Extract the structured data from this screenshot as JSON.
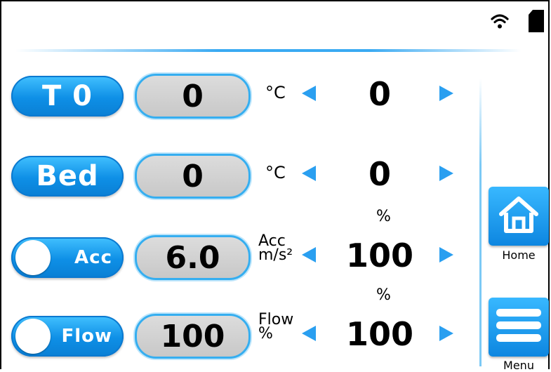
{
  "status": {
    "wifi_icon": "wifi-icon",
    "sd_icon": "sd-card-icon"
  },
  "rows": [
    {
      "label": "T 0",
      "value": "0",
      "unit": "°C",
      "target": "0"
    },
    {
      "label": "Bed",
      "value": "0",
      "unit": "°C",
      "target": "0"
    },
    {
      "label": "Acc",
      "value": "6.0",
      "unit_line1": "Acc",
      "unit_line2": "m/s²",
      "top_unit": "%",
      "target": "100"
    },
    {
      "label": "Flow",
      "value": "100",
      "unit_line1": "Flow",
      "unit_line2": "%",
      "top_unit": "%",
      "target": "100"
    }
  ],
  "side": {
    "home_label": "Home",
    "menu_label": "Menu"
  },
  "colors": {
    "accent": "#0e8fe6",
    "accent_light": "#42c1ff",
    "value_bg": "#cccccc"
  }
}
